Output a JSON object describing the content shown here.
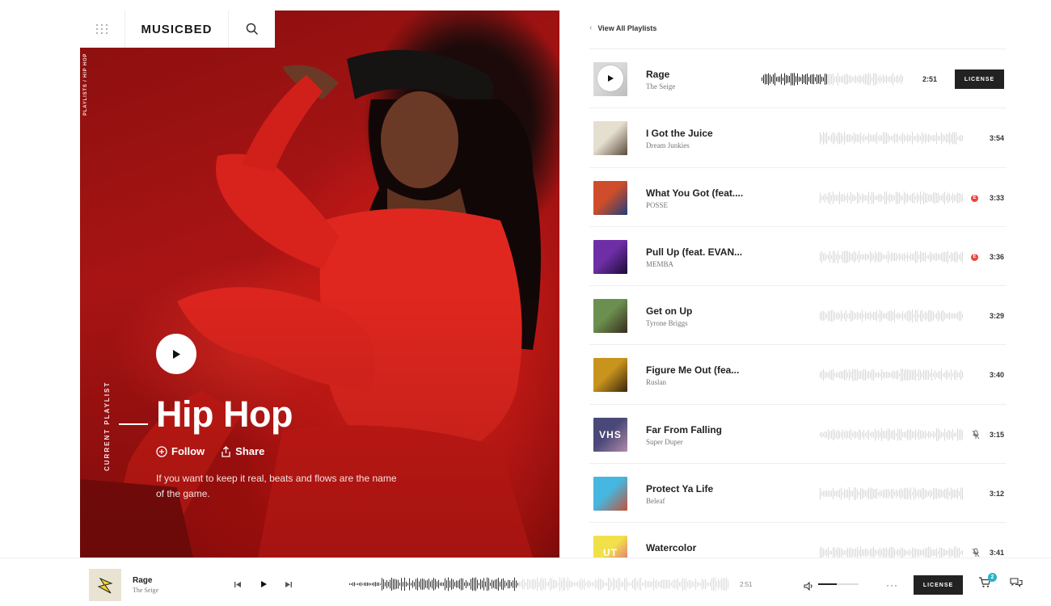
{
  "brand": {
    "logo_text": "MUSICBED"
  },
  "hero": {
    "breadcrumb": "PLAYLISTS / HIP HOP",
    "current_label": "CURRENT PLAYLIST",
    "title": "Hip Hop",
    "follow_label": "Follow",
    "share_label": "Share",
    "description": "If you want to keep it real, beats and flows are the name of the game."
  },
  "list": {
    "back_label": "View All Playlists",
    "tracks": [
      {
        "title": "Rage",
        "artist": "The Seige",
        "duration": "2:51",
        "license_label": "LICENSE",
        "playing": true,
        "explicit": false,
        "muted": false,
        "art": [
          "#d9d9d9",
          "#bdbdbd"
        ]
      },
      {
        "title": "I Got the Juice",
        "artist": "Dream Junkies",
        "duration": "3:54",
        "explicit": false,
        "muted": false,
        "art": [
          "#e5dfd0",
          "#5b4a3a"
        ]
      },
      {
        "title": "What You Got (feat....",
        "artist": "POSSE",
        "duration": "3:33",
        "explicit": true,
        "explicit_label": "E",
        "muted": false,
        "art": [
          "#cf4d2a",
          "#1f3f7a"
        ]
      },
      {
        "title": "Pull Up (feat. EVAN...",
        "artist": "MEMBA",
        "duration": "3:36",
        "explicit": true,
        "explicit_label": "E",
        "muted": false,
        "art": [
          "#6e2fa6",
          "#1b0b35"
        ]
      },
      {
        "title": "Get on Up",
        "artist": "Tyrone Briggs",
        "duration": "3:29",
        "explicit": false,
        "muted": false,
        "art": [
          "#6b8f4e",
          "#3a2a1f"
        ]
      },
      {
        "title": "Figure Me Out (fea...",
        "artist": "Ruslan",
        "duration": "3:40",
        "explicit": false,
        "muted": false,
        "art": [
          "#c9941e",
          "#3a2610"
        ]
      },
      {
        "title": "Far From Falling",
        "artist": "Super Duper",
        "duration": "3:15",
        "explicit": false,
        "muted": true,
        "art": [
          "#4a4878",
          "#b08aa8"
        ],
        "art_text": "VHS"
      },
      {
        "title": "Protect Ya Life",
        "artist": "Beleaf",
        "duration": "3:12",
        "explicit": false,
        "muted": false,
        "art": [
          "#45b7e0",
          "#c0533a"
        ]
      },
      {
        "title": "Watercolor",
        "artist": "",
        "duration": "3:41",
        "explicit": false,
        "muted": true,
        "art": [
          "#f2e04a",
          "#e05a8a"
        ],
        "art_text": "UT"
      }
    ]
  },
  "player": {
    "title": "Rage",
    "artist": "The Seige",
    "time": "2:51",
    "license_label": "LICENSE",
    "cart_count": "2",
    "progress": 0.45,
    "volume": 0.45
  }
}
